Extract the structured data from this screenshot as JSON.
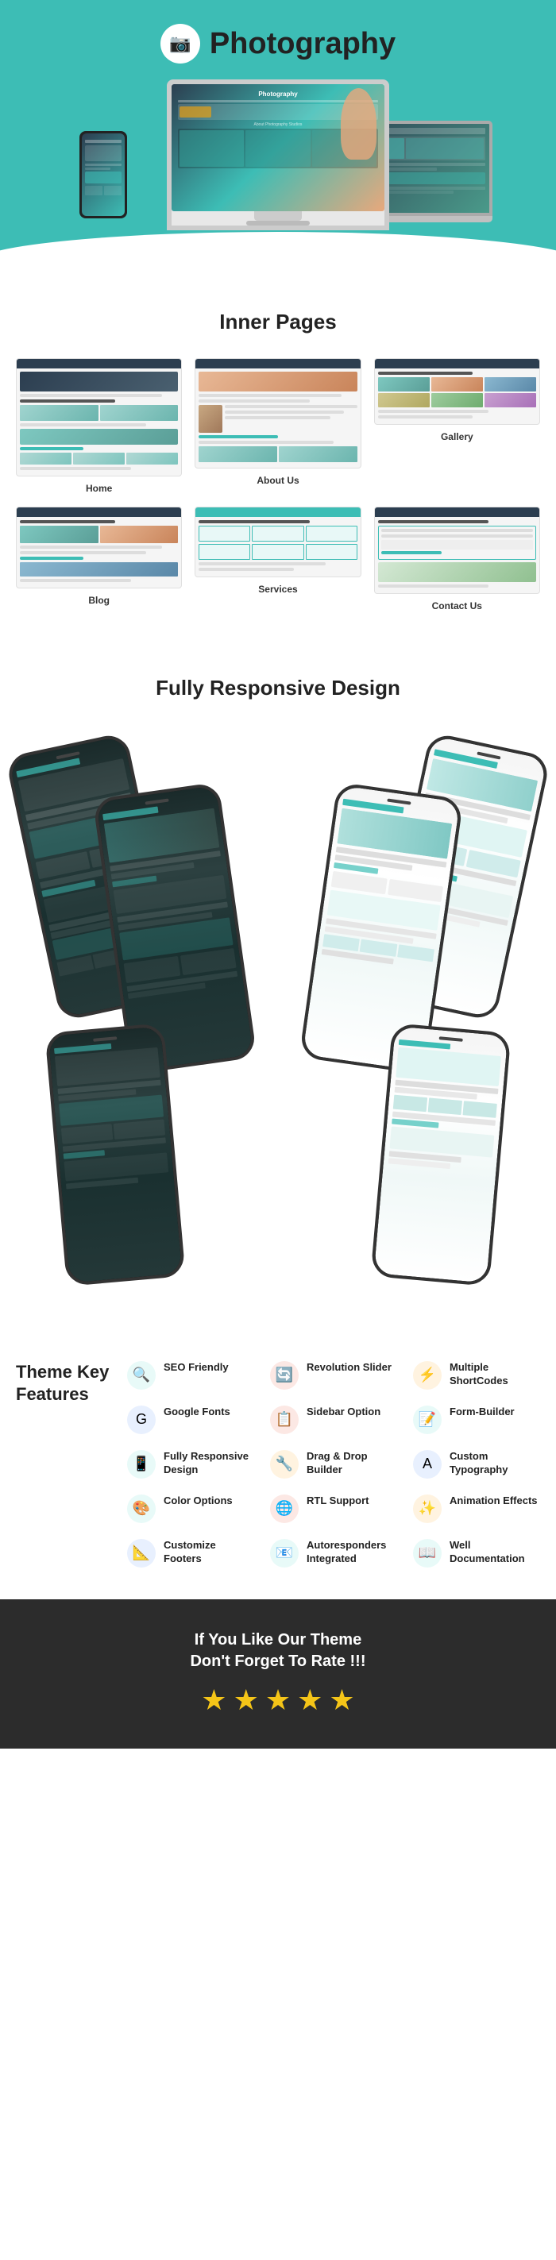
{
  "hero": {
    "logo_icon": "📷",
    "title": "Photography",
    "bg_color": "#3dbdb5"
  },
  "inner_pages": {
    "section_title": "Inner Pages",
    "pages": [
      {
        "label": "Home",
        "type": "home"
      },
      {
        "label": "About Us",
        "type": "about"
      },
      {
        "label": "Gallery",
        "type": "gallery"
      },
      {
        "label": "Blog",
        "type": "blog"
      },
      {
        "label": "Services",
        "type": "services"
      },
      {
        "label": "Contact Us",
        "type": "contact"
      }
    ]
  },
  "responsive": {
    "section_title": "Fully Responsive\nDesign"
  },
  "features": {
    "title": "Theme Key\nFeatures",
    "items": [
      {
        "icon": "🔍",
        "label": "SEO Friendly",
        "color": "#3dbdb5"
      },
      {
        "icon": "🔄",
        "label": "Revolution Slider",
        "color": "#e05c3a"
      },
      {
        "icon": "⚡",
        "label": "Multiple ShortCodes",
        "color": "#e8a030"
      },
      {
        "icon": "A",
        "label": "Google Fonts",
        "color": "#4285f4"
      },
      {
        "icon": "📋",
        "label": "Sidebar Option",
        "color": "#e05c3a"
      },
      {
        "icon": "📝",
        "label": "Form-Builder",
        "color": "#3dbdb5"
      },
      {
        "icon": "📱",
        "label": "Fully Responsive Design",
        "color": "#3dbdb5"
      },
      {
        "icon": "🔧",
        "label": "Drag & Drop Builder",
        "color": "#e8a030"
      },
      {
        "icon": "A",
        "label": "Custom Typography",
        "color": "#3a7bd5"
      },
      {
        "icon": "🎨",
        "label": "Color Options",
        "color": "#3dbdb5"
      },
      {
        "icon": "🌐",
        "label": "RTL Support",
        "color": "#e05c3a"
      },
      {
        "icon": "✨",
        "label": "Animation Effects",
        "color": "#e8a030"
      },
      {
        "icon": "📐",
        "label": "Customize Footers",
        "color": "#4285f4"
      },
      {
        "icon": "📧",
        "label": "Autoresponders Integrated",
        "color": "#3dbdb5"
      },
      {
        "icon": "📖",
        "label": "Well Documentation",
        "color": "#3dbdb5"
      }
    ]
  },
  "cta": {
    "line1": "If You Like Our Theme",
    "line2": "Don't Forget To Rate !!!",
    "stars": [
      "★",
      "★",
      "★",
      "★",
      "★"
    ]
  }
}
